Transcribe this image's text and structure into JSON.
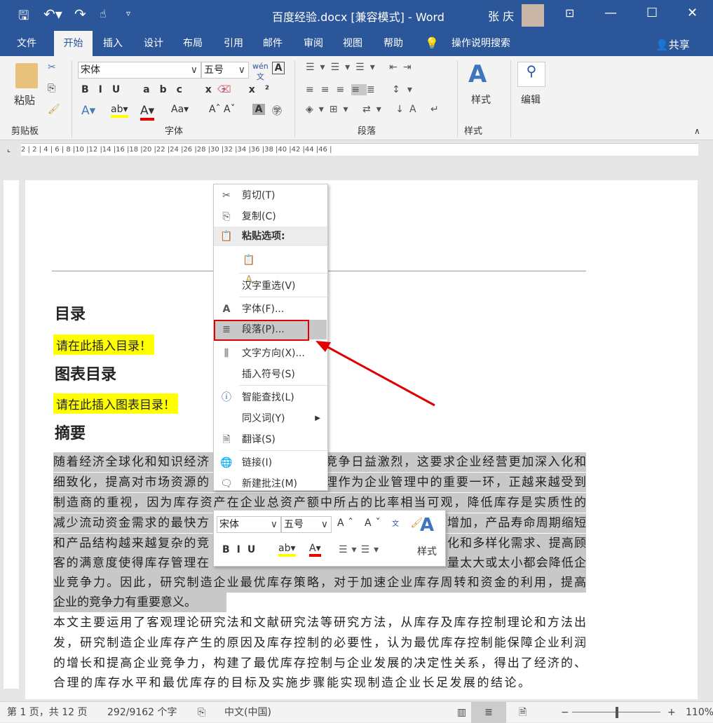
{
  "title_bar": {
    "doc_title": "百度经验.docx [兼容模式]  -  Word",
    "user": "张 庆"
  },
  "tabs": [
    "文件",
    "开始",
    "插入",
    "设计",
    "布局",
    "引用",
    "邮件",
    "审阅",
    "视图",
    "帮助"
  ],
  "tell_me": "操作说明搜索",
  "share": "共享",
  "ribbon": {
    "clipboard": "剪贴板",
    "paste": "粘贴",
    "font_group": "字体",
    "font_name": "宋体",
    "font_size": "五号",
    "paragraph_group": "段落",
    "styles_group": "样式",
    "styles_label": "样式",
    "editing_label": "编辑"
  },
  "ruler": "2 | 2 | 4 | 6 | 8 |10 |12 |14 |16 |18 |20 |22 |24 |26 |28 |30 |32 |34 |36 |38 |40 |42 |44 |46 |",
  "doc": {
    "h1": "目录",
    "toc_hint": "请在此插入目录！",
    "h2": "图表目录",
    "tof_hint": "请在此插入图表目录！",
    "h3": "摘要",
    "p1": [
      {
        "l": "随着经济全球化和知识经济",
        "r": "竞争日益激烈，这要求企业经营更加深入化和"
      },
      {
        "l": "细致化，提高对市场资源的",
        "r": "理作为企业管理中的重要一环，正越来越受到"
      },
      {
        "l": "制造商的重视，因为库存资产在企业总资产额中所占的比率相当可观，降低库存是实质性的"
      },
      {
        "l": "减少流动资金需求的最快方",
        "r": "增加，产品寿命周期缩短"
      },
      {
        "l": "和产品结构越来越复杂的竞",
        "r": "化和多样化需求、提高顾"
      },
      {
        "l": "客的满意度使得库存管理在",
        "r": "量太大或太小都会降低企"
      },
      {
        "l": "业竞争力。因此，研究制造企业最优库存策略，对于加速企业库存周转和资金的利用，提高"
      },
      {
        "l": "企业的竞争力有重要意义。"
      }
    ],
    "p2": [
      "本文主要运用了客观理论研究法和文献研究法等研究方法，从库存及库存控制理论和方法出",
      "发，研究制造企业库存产生的原因及库存控制的必要性，认为最优库存控制能保障企业利润",
      "的增长和提高企业竞争力，构建了最优库存控制与企业发展的决定性关系，得出了经济的、",
      "合理的库存水平和最优库存的目标及实施步骤能实现制造企业长足发展的结论。"
    ]
  },
  "context_menu": {
    "cut": "剪切(T)",
    "copy": "复制(C)",
    "paste_options": "粘贴选项:",
    "reconvert": "汉字重选(V)",
    "font": "字体(F)...",
    "paragraph": "段落(P)...",
    "text_direction": "文字方向(X)...",
    "insert_symbol": "插入符号(S)",
    "smart_lookup": "智能查找(L)",
    "synonyms": "同义词(Y)",
    "translate": "翻译(S)",
    "link": "链接(I)",
    "new_comment": "新建批注(M)"
  },
  "mini_toolbar": {
    "font": "宋体",
    "size": "五号",
    "styles": "样式"
  },
  "status": {
    "page": "第 1 页，共 12 页",
    "words": "292/9162 个字",
    "lang": "中文(中国)",
    "zoom": "110%"
  },
  "colors": {
    "brand": "#2b579a",
    "highlight": "#ffff00",
    "font_color": "#e00000",
    "annotation": "#e00000"
  }
}
